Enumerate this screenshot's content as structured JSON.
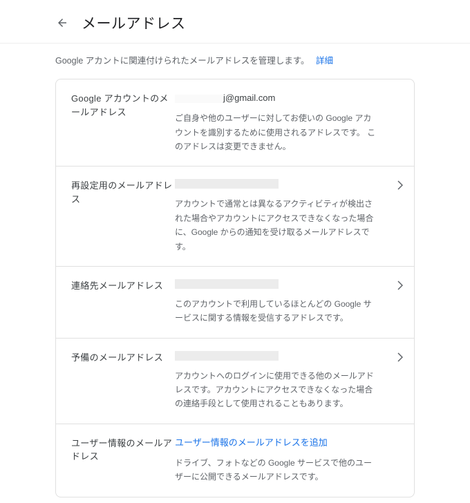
{
  "header": {
    "title": "メールアドレス"
  },
  "subtitle": {
    "text": "Google アカントに関連付けられたメールアドレスを管理します。",
    "link": "詳細"
  },
  "sections": {
    "account": {
      "label": "Google アカウントのメールアドレス",
      "value_suffix": "j@gmail.com",
      "desc_plain": "ご自身や他のユーザーに対してお使いの Google アカウントを識別するために使用されるアドレスです。",
      "desc_emph": "このアドレスは変更できません。"
    },
    "recovery": {
      "label": "再設定用のメールアドレス",
      "desc": "アカウントで通常とは異なるアクティビティが検出された場合やアカウントにアクセスできなくなった場合に、Google からの通知を受け取るメールアドレスです。"
    },
    "contact": {
      "label": "連絡先メールアドレス",
      "desc": "このアカウントで利用しているほとんどの Google サービスに関する情報を受信するアドレスです。"
    },
    "backup": {
      "label": "予備のメールアドレス",
      "desc": "アカウントへのログインに使用できる他のメールアドレスです。アカウントにアクセスできなくなった場合の連絡手段として使用されることもあります。"
    },
    "about": {
      "label": "ユーザー情報のメールアドレス",
      "action": "ユーザー情報のメールアドレスを追加",
      "desc": "ドライブ、フォトなどの Google サービスで他のユーザーに公開できるメールアドレスです。"
    }
  }
}
